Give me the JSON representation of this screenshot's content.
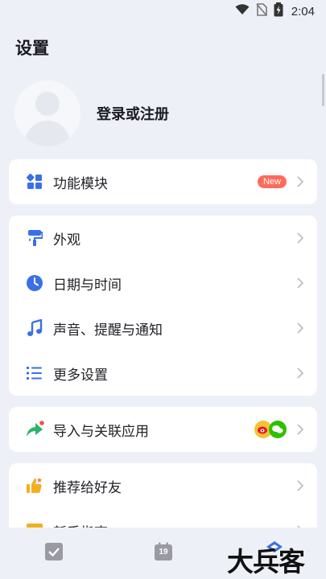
{
  "status_bar": {
    "time": "2:04"
  },
  "header": {
    "title": "设置"
  },
  "profile": {
    "login_label": "登录或注册"
  },
  "sections": {
    "modules": {
      "label": "功能模块",
      "badge": "New"
    },
    "appearance": {
      "label": "外观"
    },
    "datetime": {
      "label": "日期与时间"
    },
    "sound": {
      "label": "声音、提醒与通知"
    },
    "more": {
      "label": "更多设置"
    },
    "import": {
      "label": "导入与关联应用"
    },
    "recommend": {
      "label": "推荐给好友"
    },
    "guide": {
      "label": "新手指南"
    }
  },
  "bottom_nav": {
    "calendar_day": "19"
  },
  "watermark": {
    "text": "大兵客"
  },
  "colors": {
    "accent": "#3b6fe6",
    "badge": "#ff6b5a",
    "recommend_icon": "#f2b01e",
    "import_icon": "#2bb36b"
  }
}
